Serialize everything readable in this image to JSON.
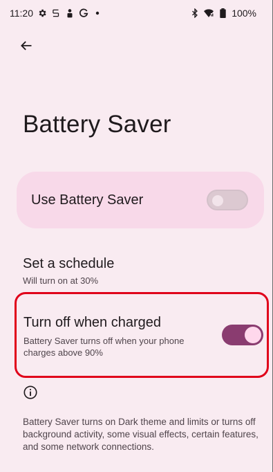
{
  "status_bar": {
    "time": "11:20",
    "battery_percent": "100%",
    "left_icons": [
      "settings-gear-icon",
      "sync-icon",
      "person-icon",
      "google-g-icon",
      "dot-icon"
    ],
    "right_icons": [
      "bluetooth-icon",
      "wifi-icon",
      "battery-icon"
    ]
  },
  "header": {
    "back_label": "Back"
  },
  "page": {
    "title": "Battery Saver"
  },
  "use_battery_saver": {
    "label": "Use Battery Saver",
    "enabled": false
  },
  "schedule": {
    "title": "Set a schedule",
    "summary": "Will turn on at 30%"
  },
  "turn_off_when_charged": {
    "title": "Turn off when charged",
    "summary": "Battery Saver turns off when your phone charges above 90%",
    "enabled": true
  },
  "footer": {
    "description": "Battery Saver turns on Dark theme and limits or turns off background activity, some visual effects, certain features, and some network connections."
  },
  "colors": {
    "background": "#F9EBF1",
    "card": "#F8D9E9",
    "switch_on_track": "#8A3C70",
    "switch_on_thumb": "#FFD8EC",
    "highlight_border": "#E0001A"
  }
}
